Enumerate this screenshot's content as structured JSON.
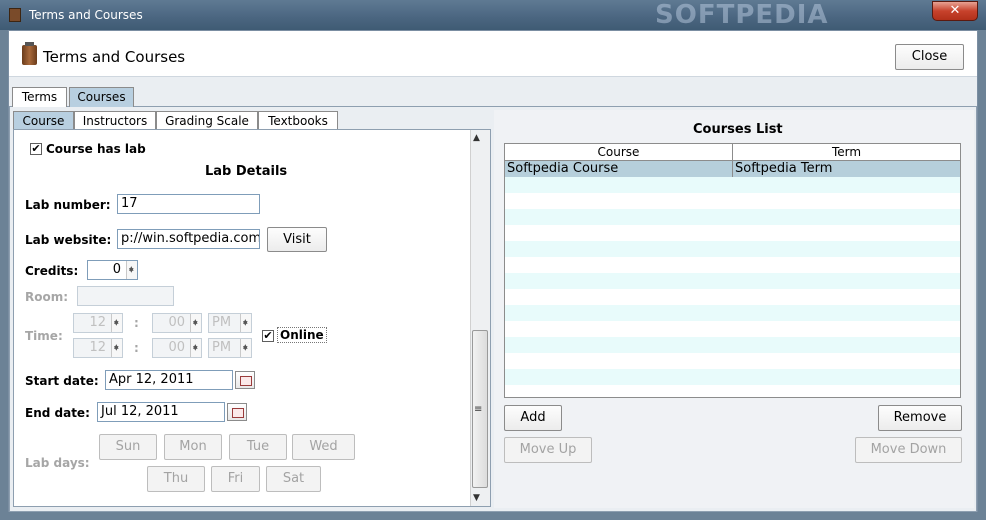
{
  "window": {
    "title": "Terms and Courses",
    "watermark": "SOFTPEDIA",
    "close_glyph": "✕"
  },
  "header": {
    "title": "Terms and Courses",
    "close_label": "Close"
  },
  "top_tabs": [
    "Terms",
    "Courses"
  ],
  "sub_tabs": [
    "Course",
    "Instructors",
    "Grading Scale",
    "Textbooks"
  ],
  "lab": {
    "has_lab_label": "Course has lab",
    "has_lab_checked": "✔",
    "section_title": "Lab Details",
    "lab_number_label": "Lab number:",
    "lab_number": "17",
    "lab_website_label": "Lab website:",
    "lab_website": "p://win.softpedia.com",
    "visit_label": "Visit",
    "credits_label": "Credits:",
    "credits": "0",
    "room_label": "Room:",
    "time_label": "Time:",
    "time_start_hour": "12",
    "time_start_min": "00",
    "time_start_ampm": "PM",
    "time_end_hour": "12",
    "time_end_min": "00",
    "time_end_ampm": "PM",
    "time_sep": ":",
    "online_label": "Online",
    "online_checked": "✔",
    "start_date_label": "Start date:",
    "start_date": "Apr 12, 2011",
    "end_date_label": "End date:",
    "end_date": "Jul 12, 2011",
    "lab_days_label": "Lab days:",
    "days": [
      "Sun",
      "Mon",
      "Tue",
      "Wed",
      "Thu",
      "Fri",
      "Sat"
    ]
  },
  "courses_list": {
    "title": "Courses List",
    "columns": [
      "Course",
      "Term"
    ],
    "rows": [
      {
        "course": "Softpedia Course",
        "term": "Softpedia Term"
      }
    ],
    "add_label": "Add",
    "remove_label": "Remove",
    "move_up_label": "Move Up",
    "move_down_label": "Move Down"
  }
}
